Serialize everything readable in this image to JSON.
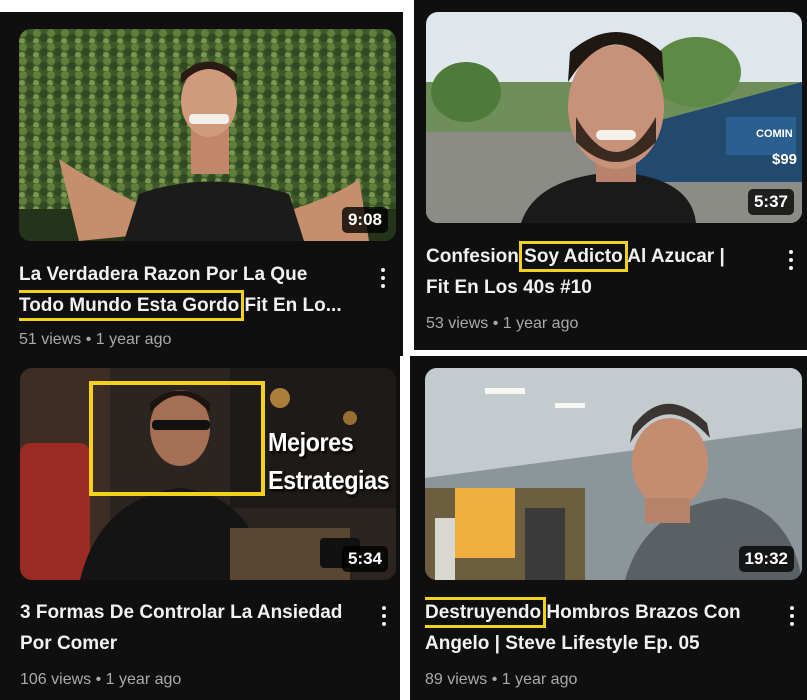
{
  "colors": {
    "panel_bg": "#0f0f0f",
    "title_text": "#f1f1f1",
    "meta_text": "#aaaaaa",
    "highlight": "#f2d21b",
    "duration_bg": "#000000"
  },
  "videos": [
    {
      "title_line1": "La Verdadera Razon Por La Que",
      "title_line2_highlight": "Todo Mundo Esta Gordo",
      "title_line2_rest": " Fit En Lo...",
      "views": "51 views",
      "separator": "•",
      "age": "1 year ago",
      "duration": "9:08"
    },
    {
      "title_line1_pre": "Confesion",
      "title_line1_highlight": "Soy Adicto",
      "title_line1_post": " Al Azucar |",
      "title_line2": "Fit En Los 40s #10",
      "views": "53 views",
      "separator": "•",
      "age": "1 year ago",
      "duration": "5:37",
      "billboard_line1": "COMIN",
      "billboard_line2": "$99"
    },
    {
      "title_line1": "3 Formas De Controlar La Ansiedad",
      "title_line2": "Por Comer",
      "views": "106 views",
      "separator": "•",
      "age": "1 year ago",
      "duration": "5:34",
      "overlay_line1": "Mejores",
      "overlay_line2": "Estrategias"
    },
    {
      "title_line1_highlight": "Destruyendo",
      "title_line1_post": " Hombros Brazos Con",
      "title_line2": "Angelo | Steve Lifestyle Ep. 05",
      "views": "89 views",
      "separator": "•",
      "age": "1 year ago",
      "duration": "19:32"
    }
  ]
}
